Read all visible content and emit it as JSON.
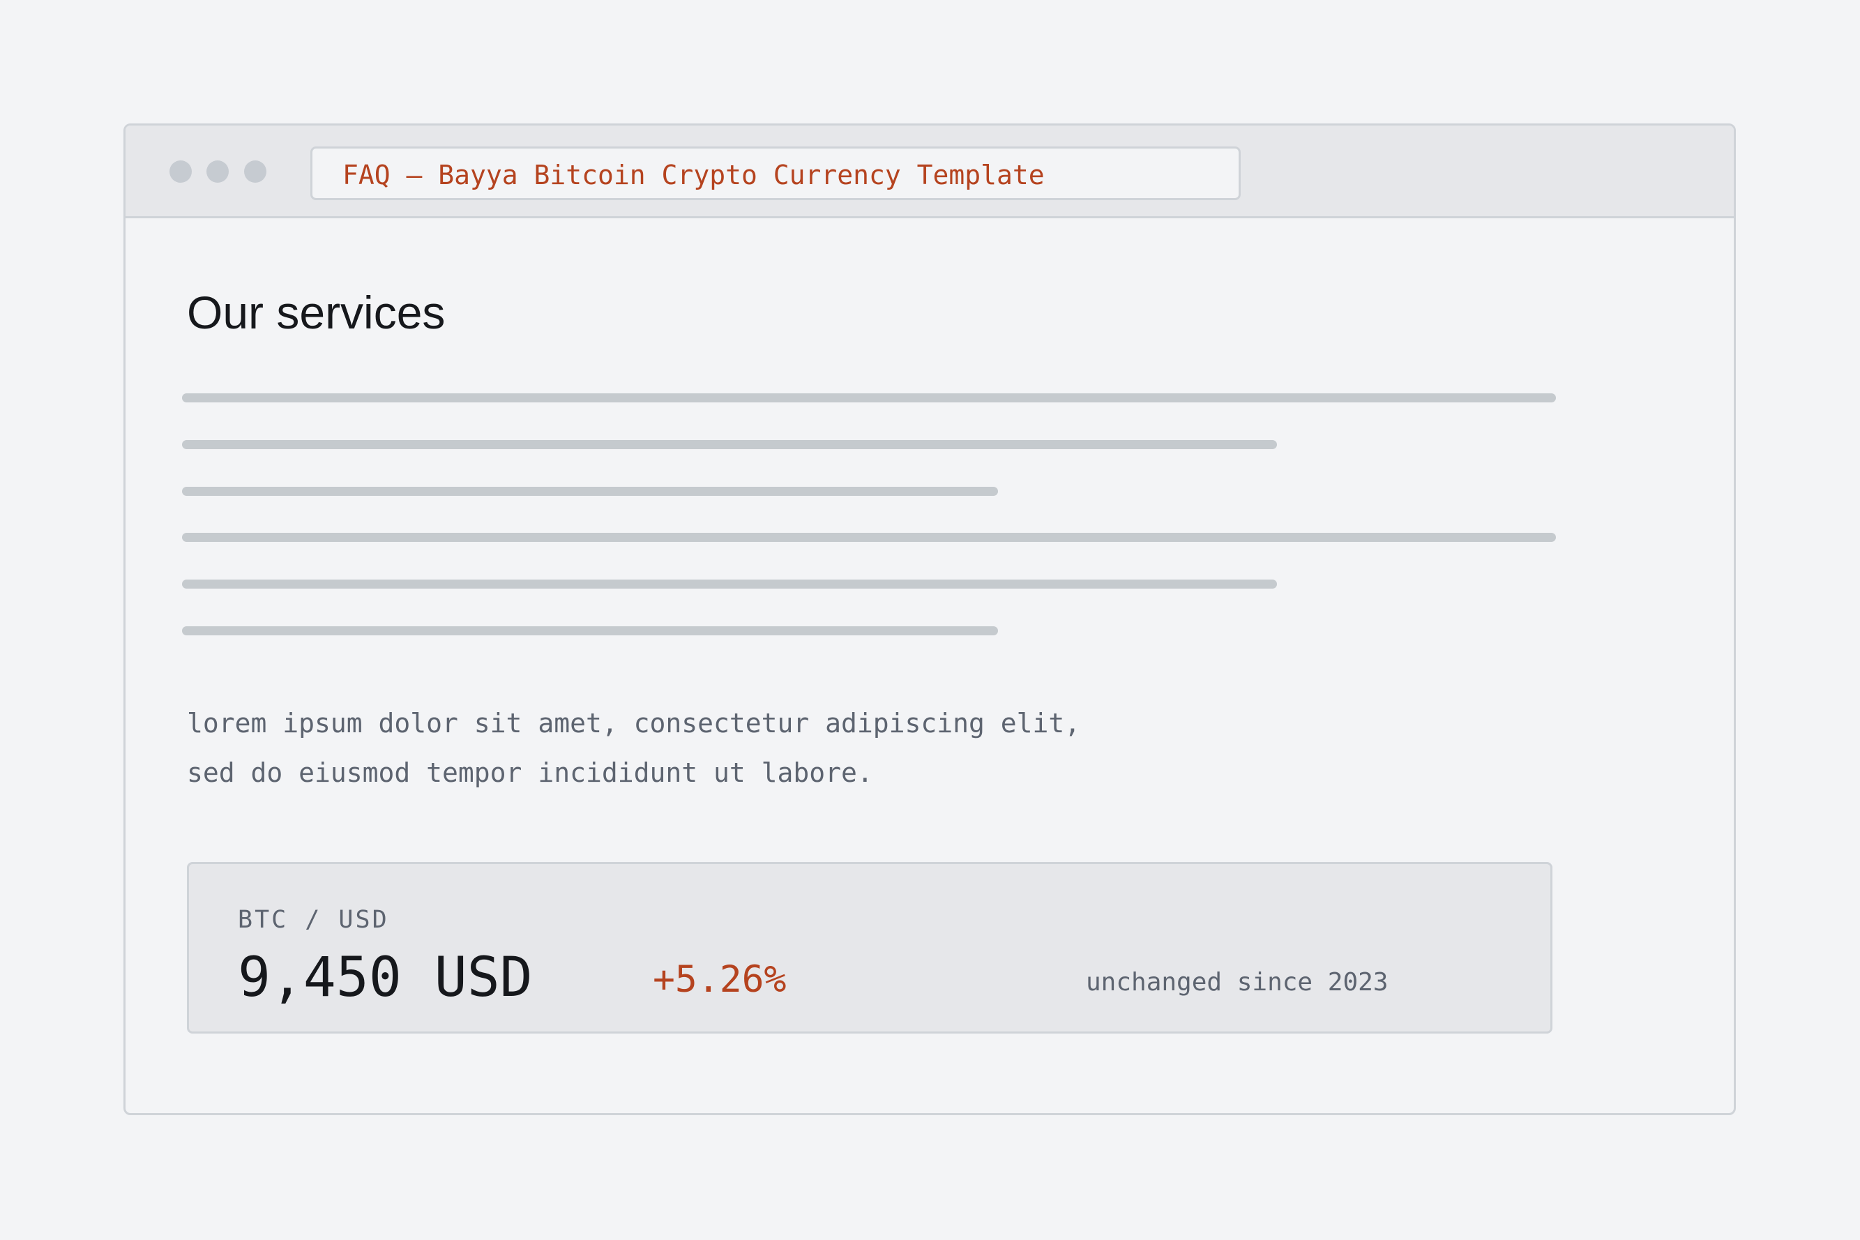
{
  "browser": {
    "tab_title": "FAQ — Bayya Bitcoin Crypto Currency Template"
  },
  "page": {
    "title": "Our services",
    "body_lines": [
      "lorem ipsum dolor sit amet, consectetur adipiscing elit,",
      "sed do eiusmod tempor incididunt ut labore."
    ]
  },
  "ticker": {
    "pair": "BTC / USD",
    "price": "9,450 USD",
    "change": "+5.26%",
    "note": "unchanged since 2023"
  },
  "colors": {
    "accent": "#b5431f",
    "text_primary": "#16181c",
    "text_muted": "#5d6470",
    "background": "#f3f4f6",
    "panel": "#e6e7ea",
    "placeholder_bar": "#c5cace"
  }
}
